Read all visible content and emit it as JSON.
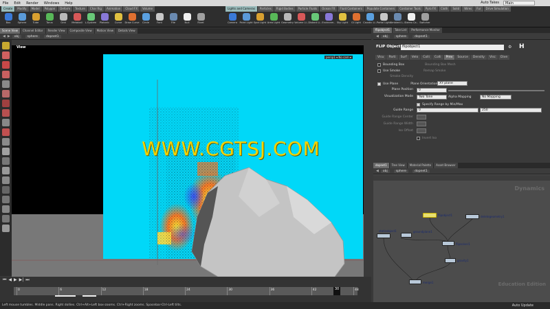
{
  "menu": {
    "items": [
      "File",
      "Edit",
      "Render",
      "Windows",
      "Help"
    ],
    "take_label": "Auto Takes",
    "desktop": "Main"
  },
  "shelf": {
    "left_tabs": [
      "Create",
      "Modify",
      "Model",
      "Polygon",
      "Deform",
      "Texture",
      "Char Rig",
      "Animation",
      "Cloud FX",
      "Volume"
    ],
    "left_tools": [
      "Box",
      "Sphere",
      "Tube",
      "Torus",
      "Grid",
      "Metaball",
      "L-System",
      "Platonic",
      "Curve",
      "Draw Curve",
      "Circle",
      "Font",
      "File",
      "Null",
      "Rivet"
    ],
    "right_tabs": [
      "Lights and Cameras",
      "Particles",
      "Rigid Bodies",
      "Particle Fluids",
      "Ocean FX",
      "Fluid Containers",
      "Populate Containers",
      "Container Tools",
      "Pyro FX",
      "Cloth",
      "Solid",
      "Wires",
      "Fur",
      "Drive Simulation"
    ],
    "right_tools": [
      "Camera",
      "Point Light",
      "Spot Light",
      "Area Light",
      "Geometry",
      "Volume Li..",
      "Distant Li..",
      "Environm..",
      "Sky Light",
      "GI Light",
      "Caustic Li..",
      "Portal Light",
      "Ambient L..",
      "Stereo Ca..",
      "Switcher"
    ]
  },
  "left_pane": {
    "tabs": [
      "Scene View",
      "Channel Editor",
      "Render View",
      "Composite View",
      "Motion View",
      "Details View"
    ],
    "path": [
      "obj",
      "sphere",
      "dopnet1"
    ],
    "view_label": "View",
    "camera_label": "persp1 ▾  No cam ▾",
    "edu_label": "Education Edition"
  },
  "watermark": "WWW.CGTSJ.COM",
  "timeline": {
    "ticks": [
      "0",
      "6",
      "12",
      "18",
      "24",
      "30",
      "36",
      "42",
      "48"
    ],
    "current_frame": "30",
    "frame_field": "30",
    "start_field": "1",
    "end_field": "10"
  },
  "status_text": "Left mouse tumbles. Middle pans. Right dollies. Ctrl+Alt+Left box-zooms. Ctrl+Right zooms. Spacebar-Ctrl-Left tilts.",
  "auto_update": "Auto Update",
  "param_pane": {
    "tabs": [
      "flipobject1",
      "Take List",
      "Performance Monitor"
    ],
    "path": [
      "obj",
      "sphere",
      "dopnet1"
    ],
    "node_type": "FLIP Object",
    "node_name": "flipobject1",
    "sub_tabs": [
      "Visu",
      "Parti",
      "Surf",
      "Velo",
      "Colli",
      "Colli",
      "Prev",
      "Source",
      "Density",
      "Visc",
      "Dive"
    ],
    "bounding_box": "Bounding Box",
    "bounding_box_mesh": "Bounding Box Mesh",
    "use_smoke": "Use Smoke",
    "remap_smoke": "Remap Smoke",
    "smoke_density": "Smoke Density",
    "use_plane": "Use Plane",
    "plane_orientation": "Plane Orientation",
    "plane_orientation_value": "XY plane",
    "plane_position": "Plane Position",
    "plane_position_value": "0",
    "vis_mode": "Visualization Mode",
    "vis_mode_value": "Two Tone",
    "alpha_mapping": "Alpha Mapping",
    "alpha_mapping_value": "No Mapping",
    "specify_range": "Specify Range by Min/Max",
    "guide_range": "Guide Range",
    "guide_range_min": "0",
    "guide_range_max": "250",
    "guide_range_center": "Guide Range Center",
    "guide_range_width": "Guide Range Width",
    "iso_offset": "Iso Offset",
    "invert_iso": "Invert Iso"
  },
  "node_pane": {
    "tabs": [
      "dopnet1",
      "Tree View",
      "Material Palette",
      "Asset Browser"
    ],
    "path": [
      "obj",
      "sphere",
      "dopnet1"
    ],
    "context_label": "Dynamics",
    "edu_label": "Education Edition",
    "nodes": [
      "flipobject1",
      "staticobject1",
      "groundplane1",
      "flipsolver1",
      "merge1",
      "gravity1",
      "output",
      "deletegeometry1"
    ]
  },
  "colors": {
    "sky": "#00d8f8",
    "watermark": "#f2d200",
    "node_label": "#1a2a70"
  }
}
